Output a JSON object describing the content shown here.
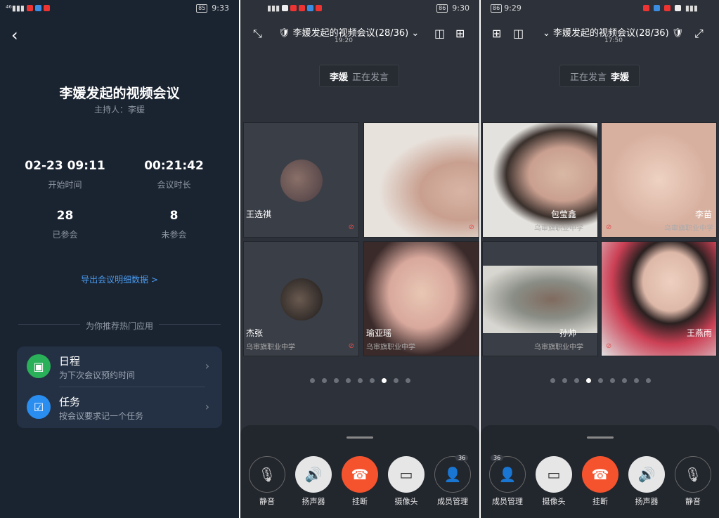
{
  "left": {
    "status": {
      "left": "⁴⁶ᵢₗ",
      "battery": "85",
      "time": "9:33"
    },
    "title": "李媛发起的视频会议",
    "host": "主持人：李媛",
    "stats": [
      {
        "value": "02-23 09:11",
        "label": "开始时间"
      },
      {
        "value": "00:21:42",
        "label": "会议时长"
      },
      {
        "value": "28",
        "label": "已参会"
      },
      {
        "value": "8",
        "label": "未参会"
      }
    ],
    "export": "导出会议明细数据 >",
    "recommend": "为你推荐热门应用",
    "apps": [
      {
        "title": "日程",
        "sub": "为下次会议预约时间",
        "color": "#2bb05a",
        "icon": "calendar-icon"
      },
      {
        "title": "任务",
        "sub": "按会议要求记一个任务",
        "color": "#2a8df0",
        "icon": "task-icon"
      }
    ]
  },
  "mid": {
    "status": {
      "battery": "86",
      "time": "9:30"
    },
    "title": "李媛发起的视频会议(28/36)",
    "time": "19:20",
    "speaker": {
      "name": "李媛",
      "text": "正在发言"
    },
    "tiles": [
      {
        "name": "王选祺",
        "org": ""
      },
      {
        "name": "",
        "org": ""
      },
      {
        "name": "杰张",
        "org": "乌审旗职业中学"
      },
      {
        "name": "瑜亚瑶",
        "org": "乌审旗职业中学"
      }
    ],
    "dots": 9,
    "active_dot": 6,
    "buttons": [
      {
        "label": "静音",
        "icon": "mic-off-icon"
      },
      {
        "label": "扬声器",
        "icon": "speaker-icon"
      },
      {
        "label": "挂断",
        "icon": "hangup-icon"
      },
      {
        "label": "摄像头",
        "icon": "camera-icon"
      },
      {
        "label": "成员管理",
        "icon": "members-icon",
        "badge": "36"
      }
    ]
  },
  "right": {
    "status": {
      "battery": "86",
      "time": "9:29"
    },
    "title": "李媛发起的视频会议(28/36)",
    "time": "17:50",
    "speaker": {
      "name": "李媛",
      "text": "正在发言"
    },
    "tiles": [
      {
        "name": "包莹鑫",
        "org": "乌审旗职业中学"
      },
      {
        "name": "李苗",
        "org": "乌审旗职业中学"
      },
      {
        "name": "孙帅",
        "org": "乌审旗职业中学"
      },
      {
        "name": "王燕雨",
        "org": ""
      }
    ],
    "dots": 9,
    "active_dot": 3,
    "buttons": [
      {
        "label": "成员管理",
        "badge": "36"
      },
      {
        "label": "摄像头"
      },
      {
        "label": "挂断"
      },
      {
        "label": "扬声器"
      },
      {
        "label": "静音"
      }
    ]
  }
}
